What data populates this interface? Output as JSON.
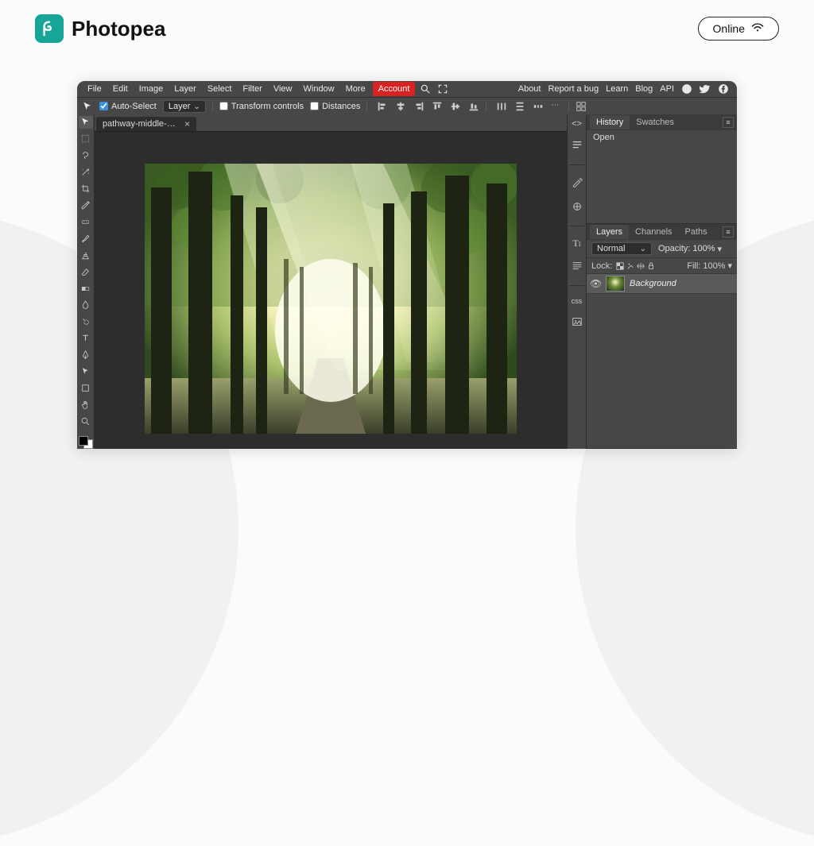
{
  "page": {
    "brand": "Photopea",
    "online_badge": "Online"
  },
  "menubar": {
    "items": [
      "File",
      "Edit",
      "Image",
      "Layer",
      "Select",
      "Filter",
      "View",
      "Window",
      "More"
    ],
    "account": "Account",
    "right_links": [
      "About",
      "Report a bug",
      "Learn",
      "Blog",
      "API"
    ]
  },
  "optionsbar": {
    "auto_select": "Auto-Select",
    "target": "Layer",
    "transform_controls": "Transform controls",
    "distances": "Distances"
  },
  "document": {
    "tab_label": "pathway-middle-gre..."
  },
  "history_panel": {
    "tabs": [
      "History",
      "Swatches"
    ],
    "items": [
      "Open"
    ]
  },
  "layers_panel": {
    "tabs": [
      "Layers",
      "Channels",
      "Paths"
    ],
    "blend_mode": "Normal",
    "opacity_label": "Opacity:",
    "opacity_value": "100%",
    "lock_label": "Lock:",
    "fill_label": "Fill:",
    "fill_value": "100%",
    "layers": [
      {
        "name": "Background"
      }
    ]
  }
}
